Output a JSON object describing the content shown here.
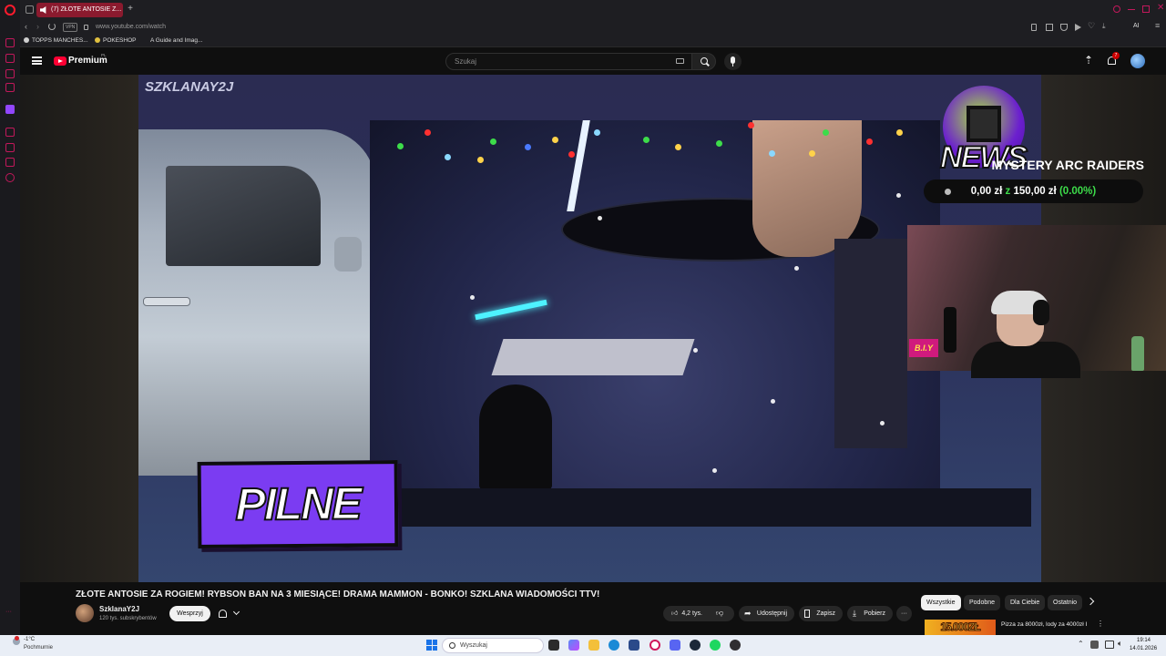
{
  "browser": {
    "tab_title": "(7) ZŁOTE ANTOSIE Z...",
    "url": "www.youtube.com/watch",
    "vpn_label": "VPN",
    "ai_label": "AI",
    "bookmarks": [
      "TOPPS MANCHES...",
      "POKESHOP",
      "A Guide and Imag..."
    ]
  },
  "youtube": {
    "logo_text": "Premium",
    "logo_region": "PL",
    "search_placeholder": "Szukaj",
    "notification_count": "7"
  },
  "stream_overlay": {
    "watermark": "SZKLANAY2J",
    "banner_text": "PILNE",
    "news_text": "NEWS",
    "goal_title": "MYSTERY ARC RAIDERS",
    "goal_current": "0,00 zł",
    "goal_sep": "z",
    "goal_target": "150,00 zł",
    "goal_pct": "(0.00%)",
    "cam_tag": "B.I.Y"
  },
  "video": {
    "title": "ZŁOTE ANTOSIE ZA ROGIEM! RYBSON BAN NA 3 MIESIĄCE! DRAMA MAMMON - BONKO! SZKLANA WIADOMOŚCI TTV!",
    "channel_name": "SzklanaY2J",
    "subscribers": "120 tys. subskrybentów",
    "support_label": "Wesprzyj",
    "likes": "4,2 tys.",
    "share_label": "Udostępnij",
    "save_label": "Zapisz",
    "download_label": "Pobierz"
  },
  "recommendations": {
    "chips": [
      "Wszystkie",
      "Podobne",
      "Dla Ciebie",
      "Ostatnio"
    ],
    "first_thumb_text": "15.000ZŁ",
    "first_title": "Pizza za 8000zł, lody za 4000zł I inne wynalazki dla bogaczy"
  },
  "taskbar": {
    "temperature": "-1°C",
    "weather": "Pochmurnie",
    "search_placeholder": "Wyszukaj",
    "time": "19:14",
    "date": "14.01.2026"
  },
  "colors": {
    "accent_red": "#ff0033",
    "opera_red": "#c2185b",
    "banner_purple": "#7b3cf2",
    "goal_green": "#3ddc4a"
  }
}
